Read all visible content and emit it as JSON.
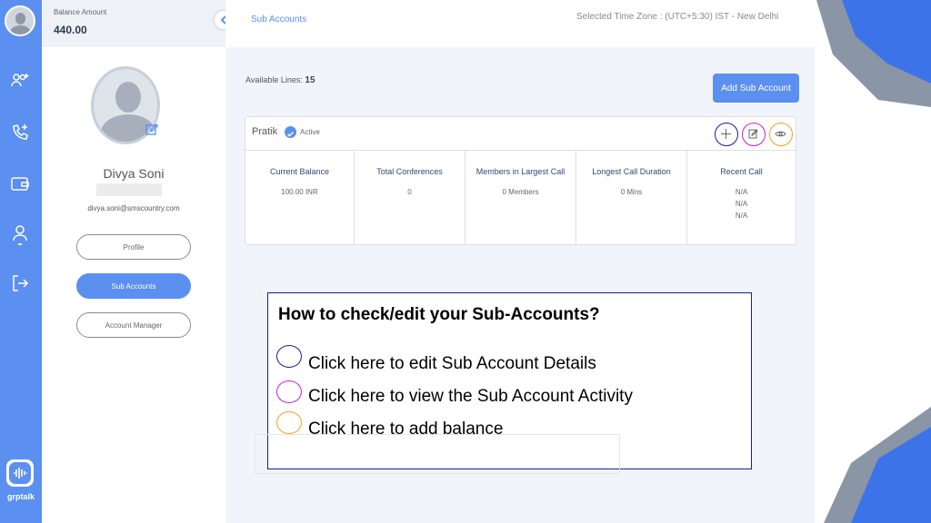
{
  "colors": {
    "primary": "#5b8ff0",
    "add_circle": "#1a1aa6",
    "edit_circle": "#d01ec8",
    "view_circle": "#f0a020"
  },
  "balance": {
    "label": "Balance Amount",
    "value": "440.00"
  },
  "profile": {
    "name": "Divya Soni",
    "email": "divya.soni@smscountry.com"
  },
  "sidebar_buttons": {
    "profile": "Profile",
    "sub_accounts": "Sub Accounts",
    "account_manager": "Account Manager"
  },
  "brand": {
    "logo_text": "grptalk"
  },
  "header": {
    "breadcrumb": "Sub Accounts",
    "timezone": "Selected Time Zone :   (UTC+5:30) IST - New Delhi"
  },
  "available_lines": {
    "label": "Available Lines:",
    "value": "15"
  },
  "add_sub_account": "Add Sub Account",
  "account": {
    "name": "Pratik",
    "status": "Active",
    "stats": [
      {
        "title": "Current Balance",
        "values": [
          "100.00 INR"
        ]
      },
      {
        "title": "Total Conferences",
        "values": [
          "0"
        ]
      },
      {
        "title": "Members in Largest Call",
        "values": [
          "0 Members"
        ]
      },
      {
        "title": "Longest Call Duration",
        "values": [
          "0 Mins"
        ]
      },
      {
        "title": "Recent Call",
        "values": [
          "N/A",
          "N/A",
          "N/A"
        ]
      }
    ]
  },
  "overlay": {
    "title": "How to check/edit your Sub-Accounts?",
    "lines": [
      "Click here to edit Sub Account Details",
      "Click here to view the Sub Account Activity",
      "Click here to add balance"
    ]
  }
}
